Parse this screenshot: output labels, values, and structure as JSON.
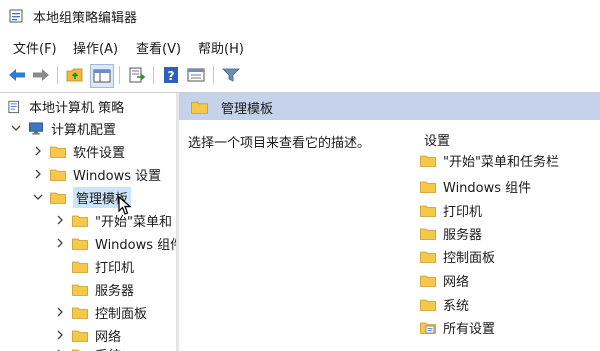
{
  "window": {
    "title": "本地组策略编辑器"
  },
  "menu": [
    "文件(F)",
    "操作(A)",
    "查看(V)",
    "帮助(H)"
  ],
  "toolbar": {
    "icons": [
      "back-arrow-icon",
      "forward-arrow-icon",
      "up-folder-icon",
      "show-hide-tree-icon",
      "export-list-icon",
      "help-icon",
      "properties-icon",
      "filter-icon"
    ]
  },
  "tree": {
    "root": "本地计算机 策略",
    "computer_config": "计算机配置",
    "software_settings": "软件设置",
    "windows_settings": "Windows 设置",
    "admin_templates": "管理模板",
    "start_menu": "\"开始\"菜单和",
    "windows_components": "Windows 组件",
    "printers": "打印机",
    "server": "服务器",
    "control_panel": "控制面板",
    "network": "网络",
    "system": "系统"
  },
  "right_pane": {
    "header_title": "管理模板",
    "description": "选择一个项目来查看它的描述。",
    "column_header": "设置",
    "items": [
      "\"开始\"菜单和任务栏",
      "Windows 组件",
      "打印机",
      "服务器",
      "控制面板",
      "网络",
      "系统",
      "所有设置"
    ]
  },
  "colors": {
    "folder": "#f6c84a",
    "header_band": "#c4d3ea",
    "selection": "#cce4f7"
  }
}
